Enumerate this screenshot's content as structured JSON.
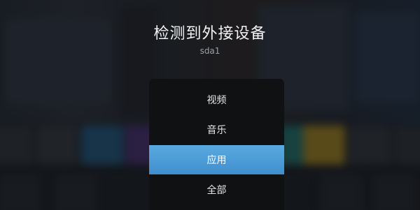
{
  "dialog": {
    "title": "检测到外接设备",
    "device_name": "sda1",
    "options": [
      {
        "label": "视频",
        "selected": false
      },
      {
        "label": "音乐",
        "selected": false
      },
      {
        "label": "应用",
        "selected": true
      },
      {
        "label": "全部",
        "selected": false
      }
    ]
  },
  "colors": {
    "selected_item": "#4a9ad6",
    "menu_background": "#0f1113",
    "title_text": "#f2f2f2",
    "subtitle_text": "#9aa0a8"
  }
}
